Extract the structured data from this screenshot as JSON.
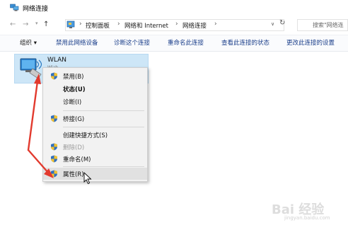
{
  "window": {
    "title": "网络连接"
  },
  "nav": {
    "back": "←",
    "forward": "→",
    "up": "↑",
    "breadcrumb": [
      "控制面板",
      "网络和 Internet",
      "网络连接"
    ],
    "search_placeholder": "搜索\"网络连"
  },
  "toolbar": {
    "items": [
      "组织 ▾",
      "禁用此网络设备",
      "诊断这个连接",
      "重命名此连接",
      "查看此连接的状态",
      "更改此连接的设置"
    ]
  },
  "connection": {
    "name": "WLAN",
    "sub": "Wlab"
  },
  "context_menu": {
    "items": [
      {
        "label": "禁用(B)",
        "icon": "shield-icon"
      },
      {
        "label": "状态(U)"
      },
      {
        "label": "诊断(I)"
      },
      {
        "label": "桥接(G)",
        "icon": "shield-icon"
      },
      {
        "label": "创建快捷方式(S)"
      },
      {
        "label": "删除(D)",
        "icon": "shield-icon"
      },
      {
        "label": "重命名(M)",
        "icon": "shield-icon"
      },
      {
        "label": "属性(R)",
        "icon": "shield-icon"
      }
    ]
  },
  "watermark": {
    "text": "Bai 经验",
    "sub": "jingyan.baidu.com"
  },
  "colors": {
    "accent_red": "#e23a2e",
    "selection_blue": "#cde6f7",
    "command_text": "#1a3e8a"
  }
}
